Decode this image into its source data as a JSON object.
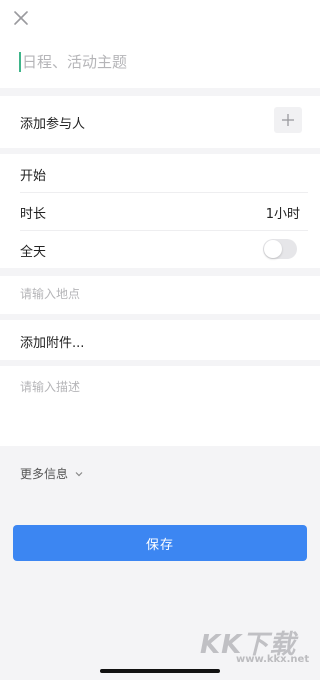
{
  "header": {
    "close_icon": "close-icon",
    "title_placeholder": "日程、活动主题"
  },
  "participants": {
    "label": "添加参与人",
    "add_icon": "plus-icon"
  },
  "time": {
    "start_label": "开始",
    "start_value": "",
    "duration_label": "时长",
    "duration_value": "1小时",
    "allday_label": "全天",
    "allday_on": false
  },
  "location": {
    "placeholder": "请输入地点"
  },
  "attachment": {
    "label": "添加附件..."
  },
  "description": {
    "placeholder": "请输入描述"
  },
  "more": {
    "label": "更多信息",
    "icon": "chevron-down-icon"
  },
  "save": {
    "label": "保存"
  },
  "watermark": {
    "text": "KK下载",
    "url": "www.kkx.net"
  },
  "colors": {
    "accent": "#3c86f2",
    "caret": "#3fb58a",
    "background": "#f4f4f6"
  }
}
